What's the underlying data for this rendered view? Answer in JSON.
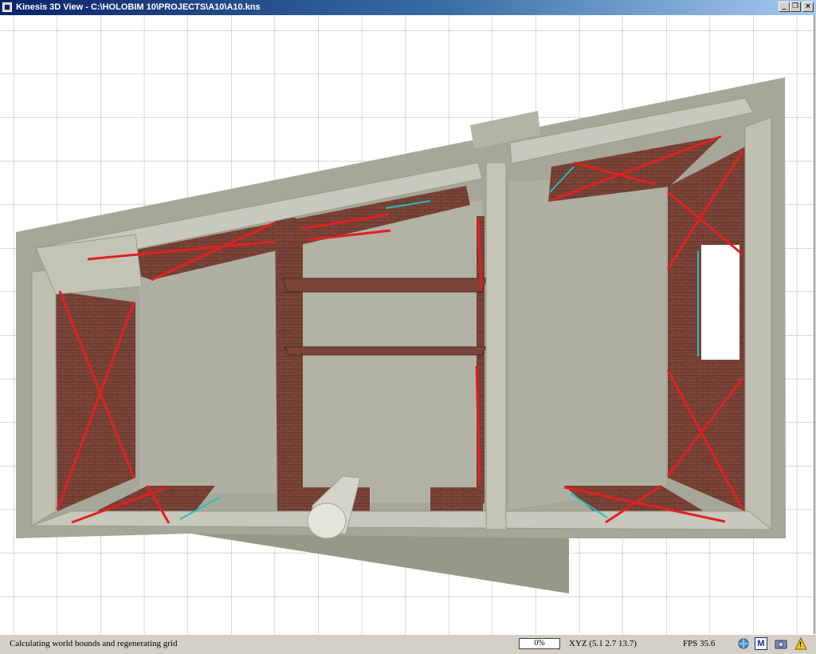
{
  "window": {
    "title": "Kinesis 3D View - C:\\HOLOBIM 10\\PROJECTS\\A10\\A10.kns",
    "minimize_label": "_",
    "restore_label": "❐",
    "close_label": "×"
  },
  "colors": {
    "titlebar_start": "#0a246a",
    "grid_line": "#b4b4b4",
    "concrete": "#a8a898",
    "brick": "#7a4438",
    "bracing": "#e02020",
    "glass_edge": "#20c0c0"
  },
  "status": {
    "message": "Calculating world bounds and regenerating grid",
    "progress": "0%",
    "xyz": "XYZ (5.1  2.7  13.7)",
    "fps": "FPS  35.6"
  },
  "status_icons": [
    "globe-icon",
    "m-icon",
    "camera-icon",
    "warning-icon"
  ],
  "status_icon_labels": {
    "m": "M",
    "warning": "!"
  }
}
